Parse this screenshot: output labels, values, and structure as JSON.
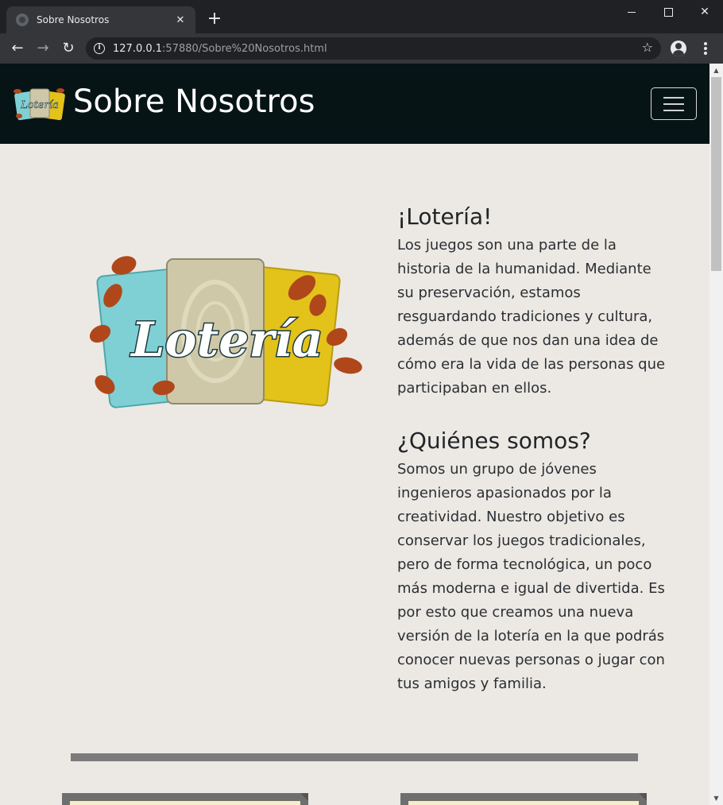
{
  "browser": {
    "tab_title": "Sobre Nosotros",
    "tab_close": "✕",
    "new_tab": "+",
    "url_host": "127.0.0.1",
    "url_rest": ":57880/Sobre%20Nosotros.html",
    "info_glyph": "i",
    "star_glyph": "☆",
    "back_glyph": "←",
    "forward_glyph": "→",
    "reload_glyph": "↻",
    "close_glyph": "✕"
  },
  "navbar": {
    "title": "Sobre Nosotros",
    "logo_text": "Lotería",
    "background": "#061416"
  },
  "hero_logo": {
    "text": "Lotería",
    "card_colors": [
      "#7fd0d4",
      "#cfc8a8",
      "#e3c21a"
    ],
    "bean_color": "#b0471a"
  },
  "sections": [
    {
      "title": "¡Lotería!",
      "body": "Los juegos son una parte de la historia de la humanidad. Mediante su preservación, estamos resguardando tradiciones y cultura, además de que nos dan una idea de cómo era la vida de las personas que participaban en ellos."
    },
    {
      "title": "¿Quiénes somos?",
      "body": "Somos un grupo de jóvenes ingenieros apasionados por la creatividad. Nuestro objetivo es conservar los juegos tradicionales, pero de forma tecnológica, un poco más moderna e igual de divertida. Es por esto que creamos una nueva versión de la lotería en la que podrás conocer nuevas personas o jugar con tus amigos y familia."
    }
  ],
  "scrollbar": {
    "up": "▲",
    "down": "▼"
  }
}
